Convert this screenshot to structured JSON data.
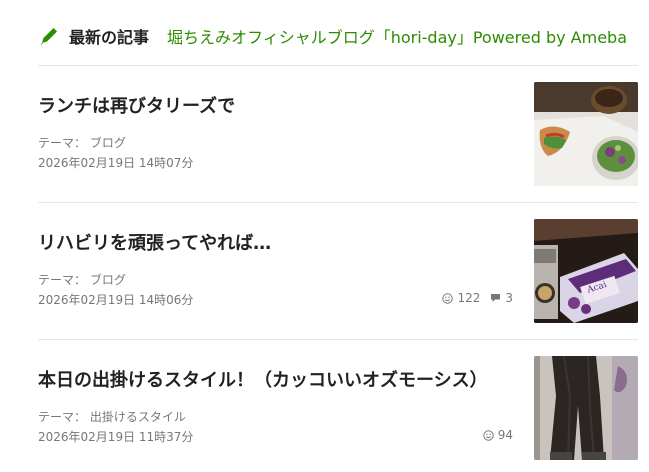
{
  "header": {
    "title": "最新の記事",
    "blog_link": "堀ちえみオフィシャルブログ「hori-day」Powered by Ameba",
    "icon": "pencil-icon",
    "accent_color": "#2d8c00"
  },
  "entries": [
    {
      "title": "ランチは再びタリーズで",
      "theme_label": "テーマ：",
      "theme": "ブログ",
      "date": "2026年02月19日 14時07分",
      "likes": "",
      "comments": "",
      "thumbnail": "lunch-photo"
    },
    {
      "title": "リハビリを頑張ってやれば…",
      "theme_label": "テーマ：",
      "theme": "ブログ",
      "date": "2026年02月19日 14時06分",
      "likes": "122",
      "comments": "3",
      "thumbnail": "coffee-acai-photo"
    },
    {
      "title": "本日の出掛けるスタイル！（カッコいいオズモーシス）",
      "theme_label": "テーマ：",
      "theme": "出掛けるスタイル",
      "date": "2026年02月19日 11時37分",
      "likes": "94",
      "comments": "",
      "thumbnail": "outfit-photo"
    }
  ]
}
